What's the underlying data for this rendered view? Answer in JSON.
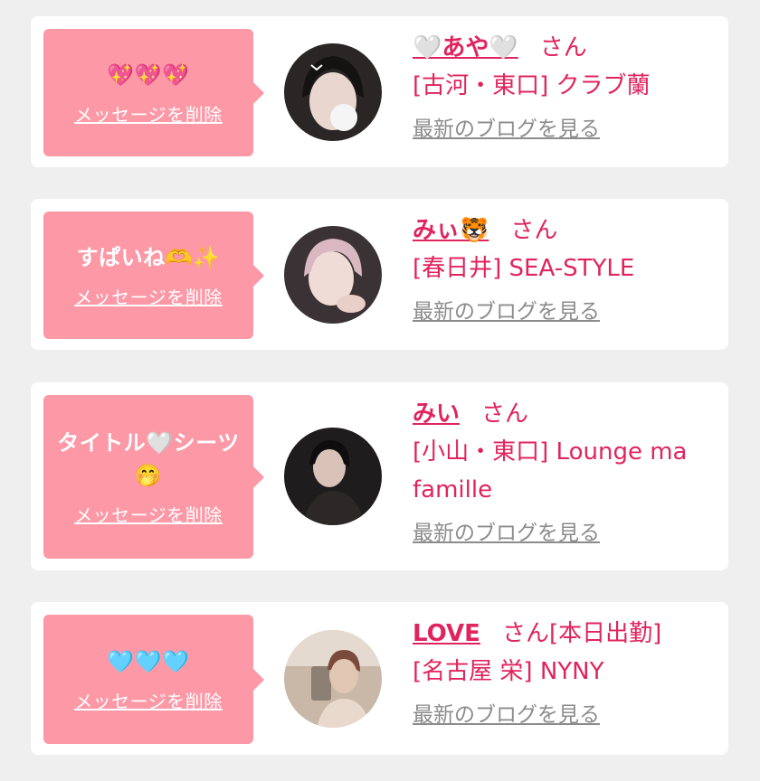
{
  "cards": [
    {
      "message": "💖💖💖",
      "delete_label": "メッセージを削除",
      "name": "🤍あや🤍",
      "san": "さん",
      "extra": "",
      "shop": "[古河・東口] クラブ蘭",
      "blog_link": "最新のブログを見る"
    },
    {
      "message": "すぱいね🫶✨",
      "delete_label": "メッセージを削除",
      "name": "みぃ🐯",
      "san": "さん",
      "extra": "",
      "shop": "[春日井] SEA-STYLE",
      "blog_link": "最新のブログを見る"
    },
    {
      "message": "タイトル🤍シーツ🤭",
      "delete_label": "メッセージを削除",
      "name": "みい",
      "san": "さん",
      "extra": "",
      "shop": "[小山・東口] Lounge ma famille",
      "blog_link": "最新のブログを見る"
    },
    {
      "message": "🩵🩵🩵",
      "delete_label": "メッセージを削除",
      "name": "LOVE",
      "san": "さん",
      "extra": "[本日出勤]",
      "shop": "[名古屋 栄] NYNY",
      "blog_link": "最新のブログを見る"
    }
  ]
}
